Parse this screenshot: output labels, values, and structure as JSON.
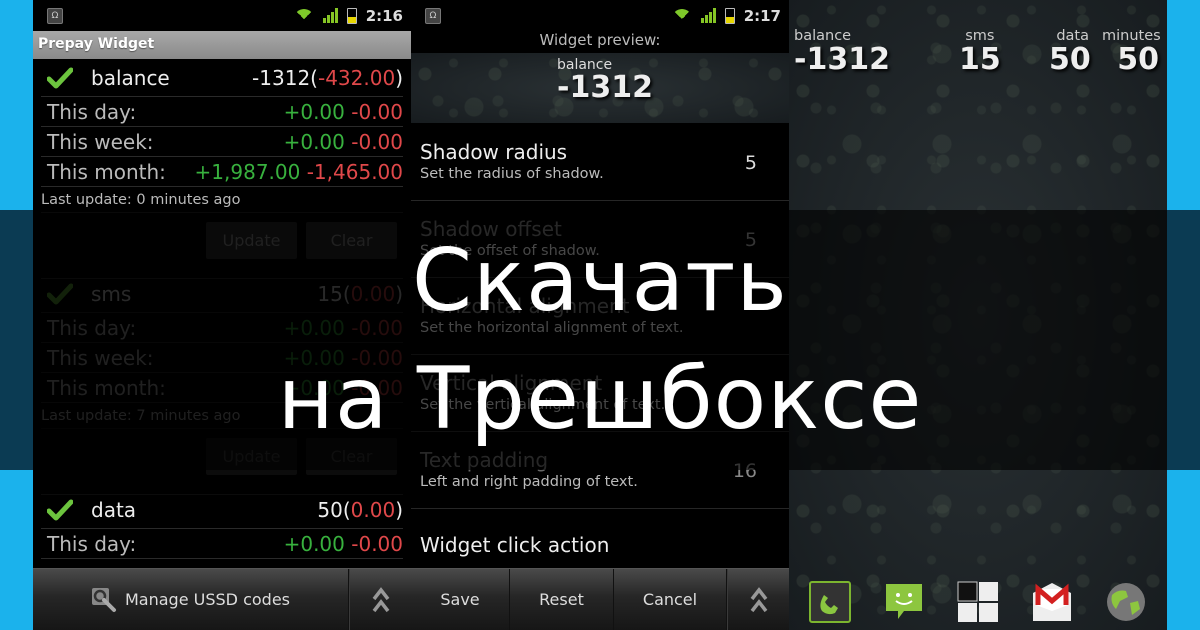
{
  "colors": {
    "brand_blue": "#1bb2ec",
    "positive": "#38b13e",
    "negative": "#e0484a",
    "check_green": "#6cc43e"
  },
  "screen1": {
    "status": {
      "time": "2:16",
      "notif_icon": "notification-icon",
      "wifi_icon": "wifi-icon",
      "signal_icon": "signal-icon",
      "battery_icon": "battery-icon"
    },
    "title": "Prepay Widget",
    "accounts": [
      {
        "name": "balance",
        "total": "-1312",
        "delta": "-432.00",
        "enabled": true,
        "rows": [
          {
            "label": "This day:",
            "plus": "+0.00",
            "minus": "-0.00"
          },
          {
            "label": "This week:",
            "plus": "+0.00",
            "minus": "-0.00"
          },
          {
            "label": "This month:",
            "plus": "+1,987.00",
            "minus": "-1,465.00"
          }
        ],
        "last_update": "Last update: 0 minutes ago",
        "update_label": "Update",
        "clear_label": "Clear"
      },
      {
        "name": "sms",
        "total": "15",
        "delta": "0.00",
        "enabled": true,
        "rows": [
          {
            "label": "This day:",
            "plus": "+0.00",
            "minus": "-0.00"
          },
          {
            "label": "This week:",
            "plus": "+0.00",
            "minus": "-0.00"
          },
          {
            "label": "This month:",
            "plus": "+0.00",
            "minus": "-0.00"
          }
        ],
        "last_update": "Last update: 7 minutes ago",
        "update_label": "Update",
        "clear_label": "Clear"
      },
      {
        "name": "data",
        "total": "50",
        "delta": "0.00",
        "enabled": true,
        "rows": [
          {
            "label": "This day:",
            "plus": "+0.00",
            "minus": "-0.00"
          }
        ]
      }
    ],
    "bottom": {
      "manage_label": "Manage USSD codes",
      "manage_icon": "wrench-search-icon",
      "more_icon": "double-chevron-up-icon"
    }
  },
  "screen2": {
    "status": {
      "time": "2:17"
    },
    "preview_label": "Widget preview:",
    "preview": {
      "label": "balance",
      "value": "-1312"
    },
    "prefs": [
      {
        "title": "Shadow radius",
        "summary": "Set the radius of shadow.",
        "value": "5",
        "enabled": true
      },
      {
        "title": "Shadow offset",
        "summary": "Set the offset of shadow.",
        "value": "5",
        "enabled": false
      },
      {
        "title": "Horizontal alignment",
        "summary": "Set the horizontal alignment of text.",
        "value": "",
        "enabled": false
      },
      {
        "title": "Vertical alignment",
        "summary": "Set the vertical alignment of text.",
        "value": "",
        "enabled": false
      },
      {
        "title": "Text padding",
        "summary": "Left and right padding of text.",
        "value": "16",
        "enabled": false
      },
      {
        "title": "Widget click action",
        "summary": "",
        "value": "",
        "enabled": true
      }
    ],
    "bottom": {
      "save_label": "Save",
      "reset_label": "Reset",
      "cancel_label": "Cancel"
    }
  },
  "screen3": {
    "widgets": [
      {
        "label": "balance",
        "value": "-1312"
      },
      {
        "label": "sms",
        "value": "15"
      },
      {
        "label": "data",
        "value": "50"
      },
      {
        "label": "minutes",
        "value": "50"
      }
    ],
    "dock": [
      "phone-icon",
      "messaging-icon",
      "app-drawer-icon",
      "gmail-icon",
      "browser-globe-icon"
    ]
  },
  "overlay": {
    "line1": "Скачать",
    "line2": "на Трешбоксе"
  }
}
